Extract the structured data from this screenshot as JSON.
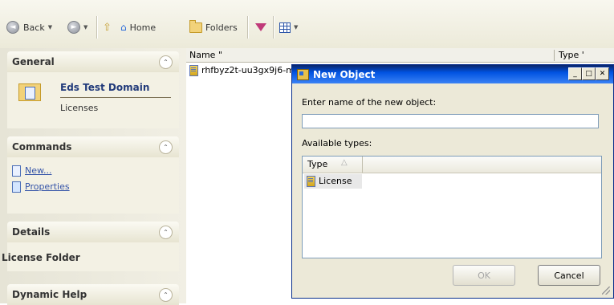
{
  "toolbar": {
    "back_label": "Back",
    "home_label": "Home",
    "folders_label": "Folders"
  },
  "left_pane": {
    "general": {
      "title": "General",
      "domain_name": "Eds Test Domain",
      "sub_label": "Licenses"
    },
    "commands": {
      "title": "Commands",
      "links": [
        "New...",
        "Properties"
      ]
    },
    "details": {
      "title": "Details",
      "text": "License Folder"
    },
    "dynamic_help": {
      "title": "Dynamic Help"
    }
  },
  "list": {
    "columns": [
      "Name",
      "Type"
    ],
    "rows": [
      {
        "name": "rhfbyz2t-uu3gx9j6-m"
      }
    ]
  },
  "dialog": {
    "title": "New Object",
    "prompt": "Enter name of the new object:",
    "name_value": "",
    "available_types_label": "Available types:",
    "types_column": "Type",
    "types": [
      "License"
    ],
    "ok_label": "OK",
    "cancel_label": "Cancel"
  }
}
